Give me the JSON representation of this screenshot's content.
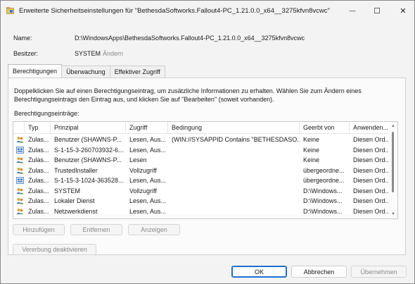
{
  "window": {
    "title": "Erweiterte Sicherheitseinstellungen für \"BethesdaSoftworks.Fallout4-PC_1.21.0.0_x64__3275kfvn8vcwc\"",
    "minimize_glyph": "—",
    "maximize_glyph": "☐",
    "close_glyph": "✕"
  },
  "header": {
    "name_label": "Name:",
    "name_value": "D:\\WindowsApps\\BethesdaSoftworks.Fallout4-PC_1.21.0.0_x64__3275kfvn8vcwc",
    "owner_label": "Besitzer:",
    "owner_value": "SYSTEM",
    "owner_change_link": "Ändern"
  },
  "tabs": [
    {
      "label": "Berechtigungen",
      "active": true
    },
    {
      "label": "Überwachung",
      "active": false
    },
    {
      "label": "Effektiver Zugriff",
      "active": false
    }
  ],
  "panel": {
    "info_text": "Doppelklicken Sie auf einen Berechtigungseintrag, um zusätzliche Informationen zu erhalten. Wählen Sie zum Ändern eines Berechtigungseintrags den Eintrag aus, und klicken Sie auf \"Bearbeiten\" (soweit vorhanden).",
    "entries_label": "Berechtigungseinträge:"
  },
  "table": {
    "columns": [
      "Typ",
      "Prinzipal",
      "Zugriff",
      "Bedingung",
      "Geerbt von",
      "Anwenden..."
    ],
    "rows": [
      {
        "icon": "user-group-icon",
        "typ": "Zulas...",
        "prinzipal": "Benutzer (SHAWNS-P...",
        "zugriff": "Lesen, Aus...",
        "bedingung": "(WIN://SYSAPPID Contains \"BETHESDASO...",
        "geerbt": "Keine",
        "anwenden": "Diesen Ord..."
      },
      {
        "icon": "app-package-icon",
        "typ": "Zulas...",
        "prinzipal": "S-1-15-3-260703932-6...",
        "zugriff": "Lesen, Aus...",
        "bedingung": "",
        "geerbt": "Keine",
        "anwenden": "Diesen Ord..."
      },
      {
        "icon": "user-group-icon",
        "typ": "Zulas...",
        "prinzipal": "Benutzer (SHAWNS-P...",
        "zugriff": "Lesen",
        "bedingung": "",
        "geerbt": "Keine",
        "anwenden": "Diesen Ord..."
      },
      {
        "icon": "user-group-icon",
        "typ": "Zulas...",
        "prinzipal": "TrustedInstaller",
        "zugriff": "Vollzugriff",
        "bedingung": "",
        "geerbt": "übergeordne...",
        "anwenden": "Diesen Ord..."
      },
      {
        "icon": "app-package-icon",
        "typ": "Zulas...",
        "prinzipal": "S-1-15-3-1024-363528...",
        "zugriff": "Lesen, Aus...",
        "bedingung": "",
        "geerbt": "übergeordne...",
        "anwenden": "Diesen Ord..."
      },
      {
        "icon": "user-group-icon",
        "typ": "Zulas...",
        "prinzipal": "SYSTEM",
        "zugriff": "Vollzugriff",
        "bedingung": "",
        "geerbt": "D:\\Windows...",
        "anwenden": "Diesen Ord..."
      },
      {
        "icon": "user-group-icon",
        "typ": "Zulas...",
        "prinzipal": "Lokaler Dienst",
        "zugriff": "Lesen, Aus...",
        "bedingung": "",
        "geerbt": "D:\\Windows...",
        "anwenden": "Diesen Ord..."
      },
      {
        "icon": "user-group-icon",
        "typ": "Zulas...",
        "prinzipal": "Netzwerkdienst",
        "zugriff": "Lesen, Aus...",
        "bedingung": "",
        "geerbt": "D:\\Windows...",
        "anwenden": "Diesen Ord..."
      }
    ]
  },
  "actions": {
    "add": "Hinzufügen",
    "remove": "Entfernen",
    "view": "Anzeigen",
    "disable_inheritance": "Vererbung deaktivieren"
  },
  "footer": {
    "ok": "OK",
    "cancel": "Abbrechen",
    "apply": "Übernehmen"
  },
  "colors": {
    "accent": "#1d6fd1",
    "disabled_text": "#8a8a8a"
  }
}
